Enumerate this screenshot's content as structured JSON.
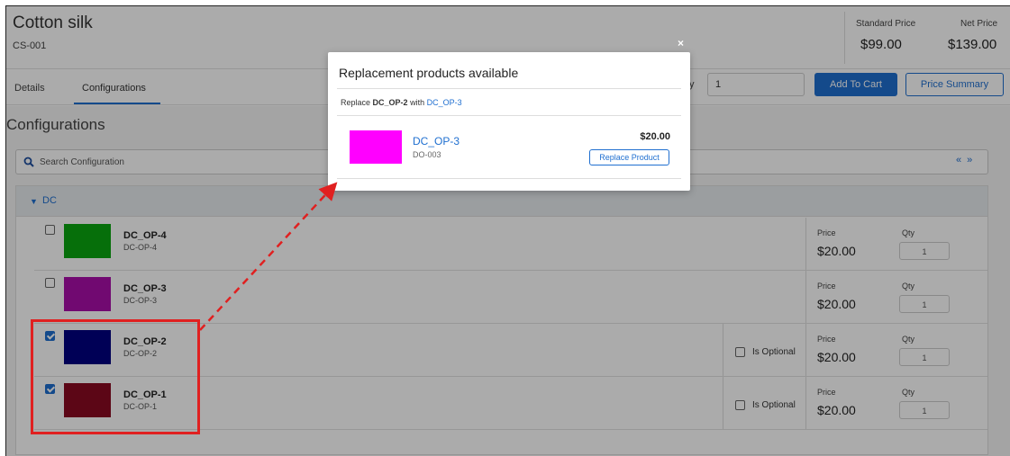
{
  "product": {
    "name": "Cotton silk",
    "code": "CS-001",
    "standard_price_label": "Standard Price",
    "standard_price": "$99.00",
    "net_price_label": "Net Price",
    "net_price": "$139.00"
  },
  "tabs": [
    {
      "label": "Details",
      "active": false
    },
    {
      "label": "Configurations",
      "active": true
    }
  ],
  "toolbar": {
    "qty_label": "y",
    "qty_value": "1",
    "add_to_cart": "Add To Cart",
    "price_summary": "Price Summary"
  },
  "configurations": {
    "title": "Configurations",
    "search_placeholder": "Search Configuration",
    "expand_icons": "«»",
    "group": {
      "name": "DC",
      "items": [
        {
          "name": "DC_OP-4",
          "code": "DC-OP-4",
          "color": "#0aa60f",
          "checked": false,
          "price_label": "Price",
          "price": "$20.00",
          "qty_label": "Qty",
          "qty": "1"
        },
        {
          "name": "DC_OP-3",
          "code": "DC-OP-3",
          "color": "#a90ea9",
          "checked": false,
          "price_label": "Price",
          "price": "$20.00",
          "qty_label": "Qty",
          "qty": "1"
        },
        {
          "name": "DC_OP-2",
          "code": "DC-OP-2",
          "color": "#000080",
          "checked": true,
          "optional_label": "Is Optional",
          "price_label": "Price",
          "price": "$20.00",
          "qty_label": "Qty",
          "qty": "1"
        },
        {
          "name": "DC_OP-1",
          "code": "DC-OP-1",
          "color": "#8a0a22",
          "checked": true,
          "optional_label": "Is Optional",
          "price_label": "Price",
          "price": "$20.00",
          "qty_label": "Qty",
          "qty": "1"
        }
      ]
    }
  },
  "modal": {
    "close": "×",
    "title": "Replacement products available",
    "replace_prefix": "Replace",
    "replace_from": "DC_OP-2",
    "replace_with_word": "with",
    "replace_to": "DC_OP-3",
    "product_name": "DC_OP-3",
    "product_code": "DO-003",
    "product_price": "$20.00",
    "product_color": "#ff00ff",
    "replace_button": "Replace Product"
  }
}
